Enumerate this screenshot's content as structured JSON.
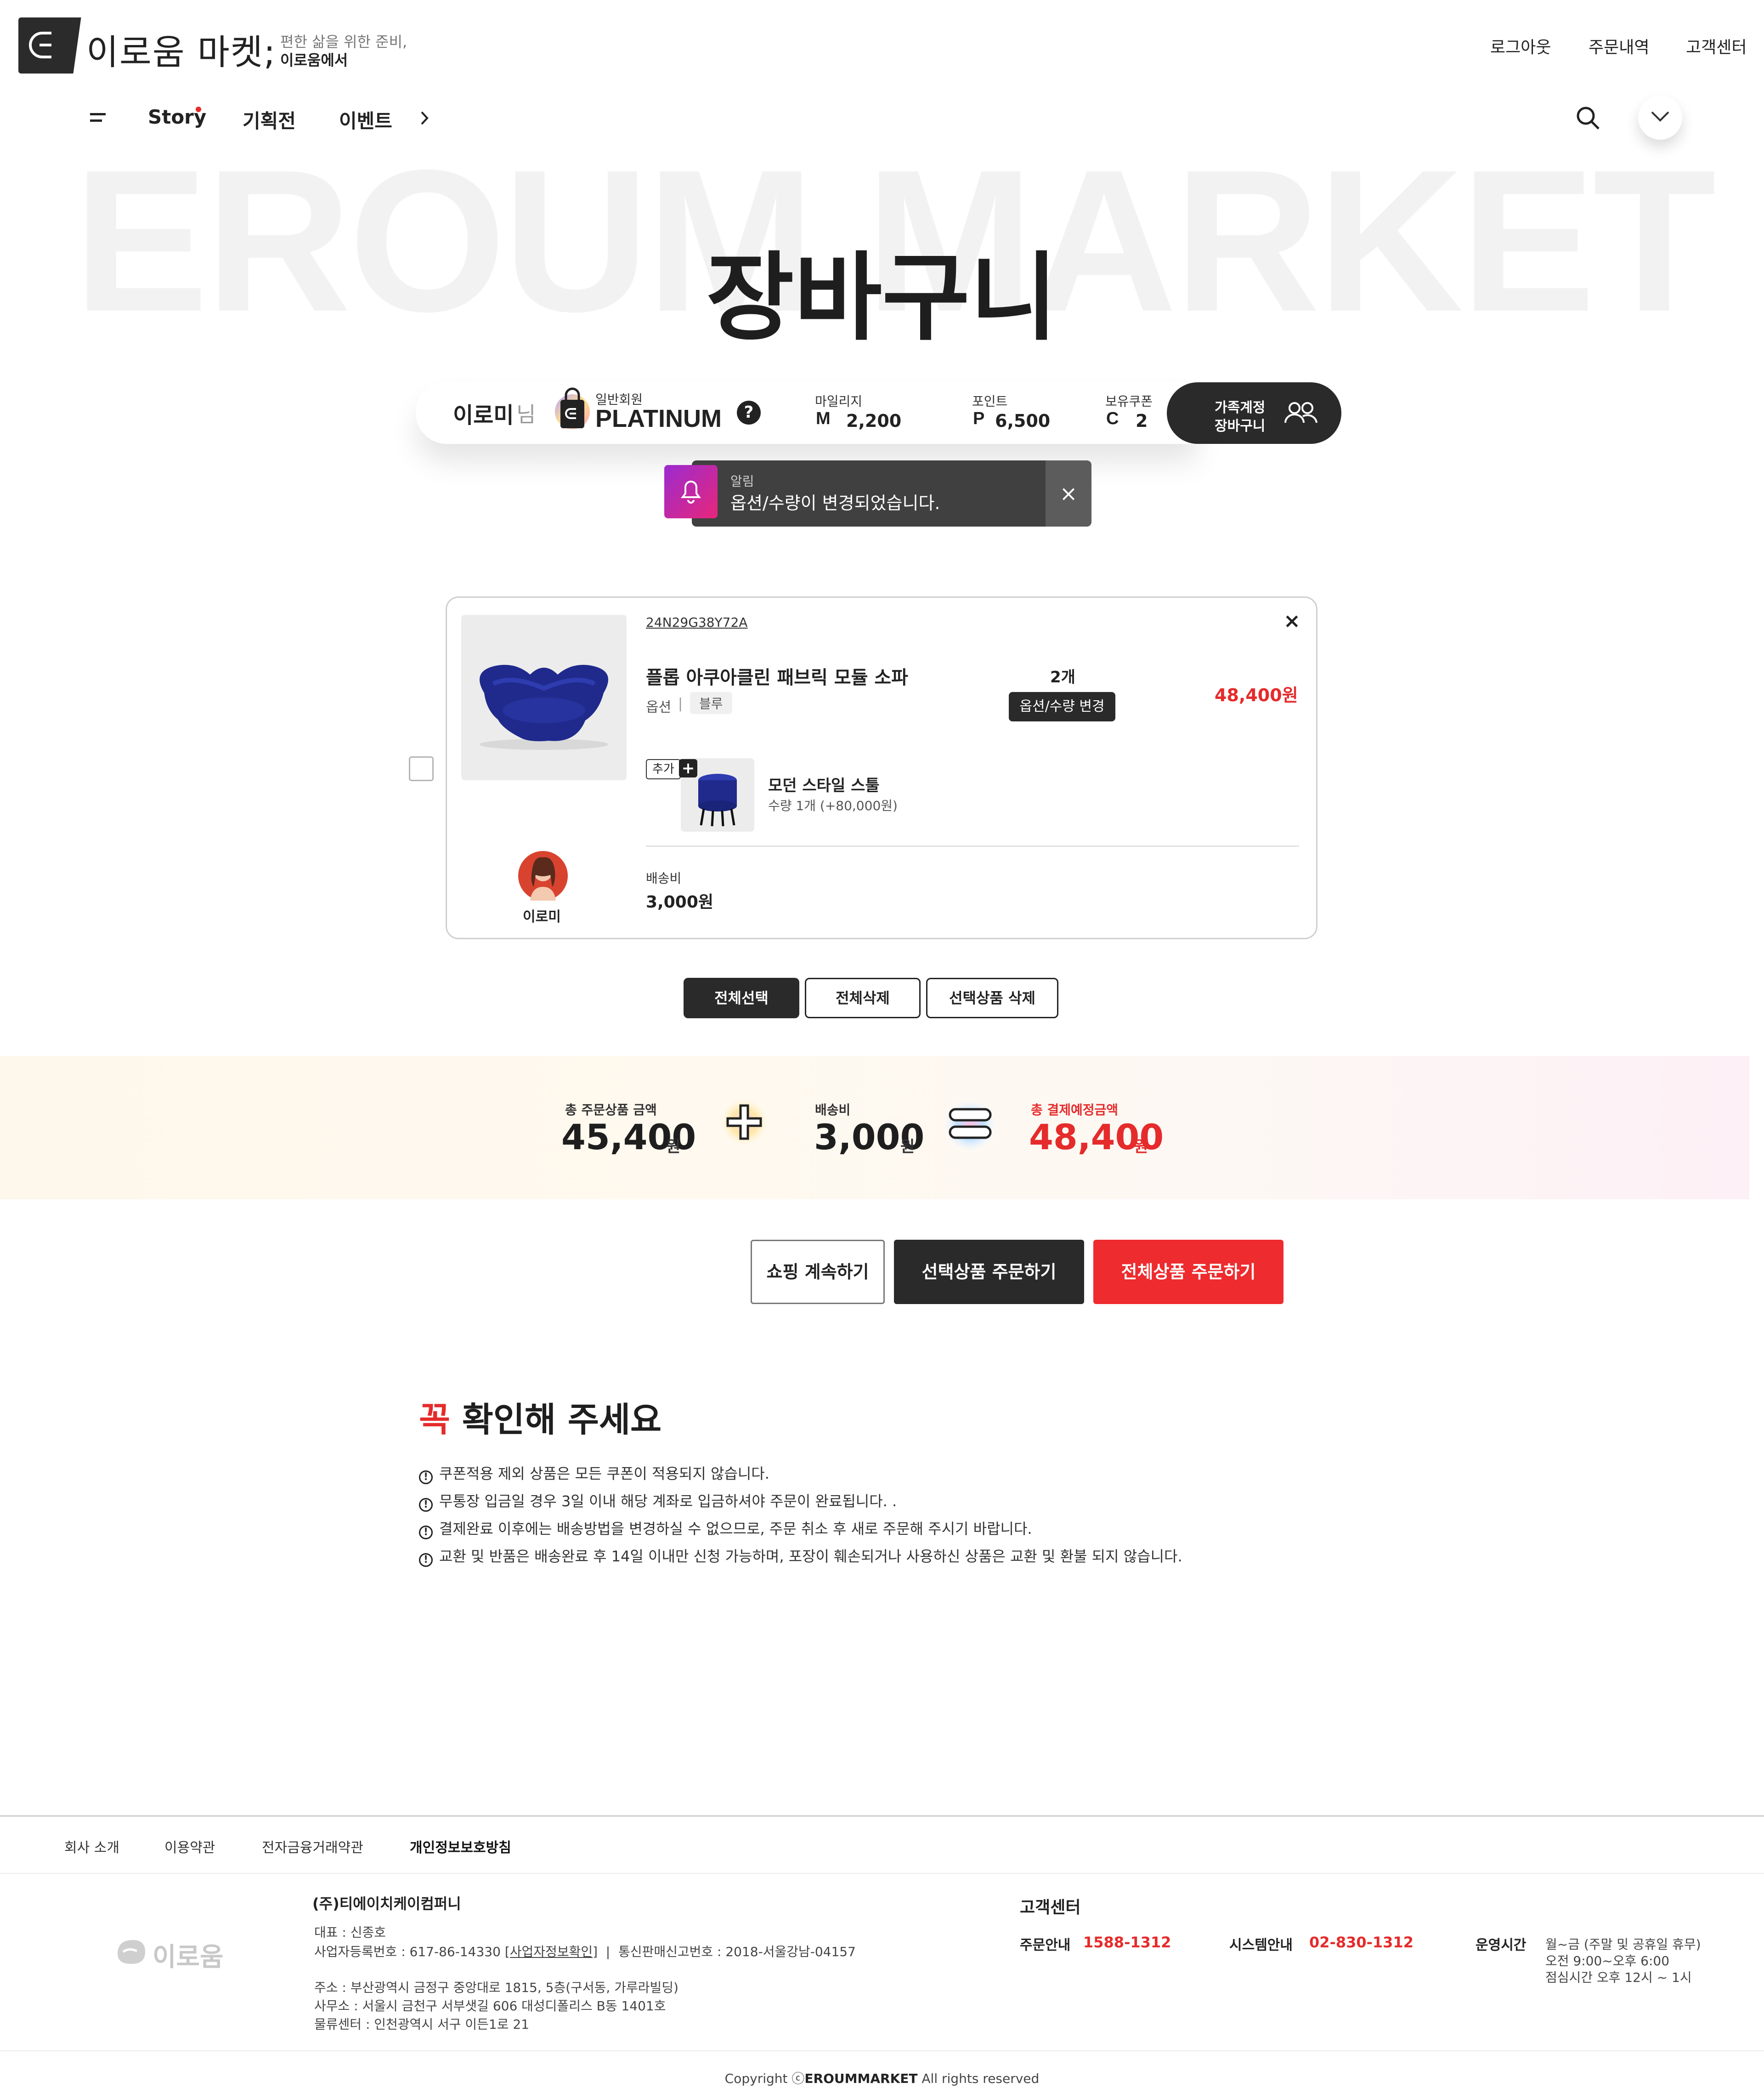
{
  "header": {
    "brand": "이로움 마켓;",
    "tagline_line1": "편한 삶을 위한 준비,",
    "tagline_line2": "이로움에서",
    "top_links": [
      "로그아웃",
      "주문내역",
      "고객센터"
    ],
    "nav": [
      "Story",
      "기획전",
      "이벤트"
    ],
    "watermark": "EROUM MARKET"
  },
  "page": {
    "title": "장바구니"
  },
  "member": {
    "name": "이로미",
    "honorific": "님",
    "grade_label": "일반회원",
    "grade": "PLATINUM",
    "mileage_label": "마일리지",
    "mileage_value": "2,200",
    "point_label": "포인트",
    "point_value": "6,500",
    "coupon_label": "보유쿠폰",
    "coupon_value": "2",
    "family_cart_line1": "가족계정",
    "family_cart_line2": "장바구니"
  },
  "toast": {
    "title": "알림",
    "message": "옵션/수량이 변경되었습니다.",
    "close": "×"
  },
  "cart_item": {
    "code": "24N29G38Y72A",
    "name": "플롭 아쿠아클린 패브릭 모듈 소파",
    "option_label": "옵션",
    "option_value": "블루",
    "quantity": "2개",
    "change_button": "옵션/수량 변경",
    "price": "48,400원",
    "addon_badge": "추가",
    "addon_name": "모던 스타일 스툴",
    "addon_detail": "수량 1개 (+80,000원)",
    "owner_name": "이로미",
    "shipping_label": "배송비",
    "shipping_value": "3,000원",
    "remove": "×"
  },
  "cart_actions": [
    "전체선택",
    "전체삭제",
    "선택상품 삭제"
  ],
  "summary": {
    "items_label": "총 주문상품 금액",
    "items_value": "45,400",
    "shipping_label": "배송비",
    "shipping_value": "3,000",
    "total_label": "총 결제예정금액",
    "total_value": "48,400",
    "unit": "원"
  },
  "order_buttons": [
    "쇼핑 계속하기",
    "선택상품 주문하기",
    "전체상품 주문하기"
  ],
  "notice": {
    "title_accent": "꼭",
    "title_rest": " 확인해 주세요",
    "items": [
      "쿠폰적용 제외 상품은 모든 쿠폰이 적용되지 않습니다.",
      "무통장 입금일 경우 3일 이내 해당 계좌로 입금하셔야 주문이 완료됩니다. .",
      "결제완료 이후에는 배송방법을 변경하실 수 없으므로, 주문 취소 후 새로 주문해 주시기 바랍니다.",
      "교환 및 반품은 배송완료 후 14일 이내만 신청 가능하며, 포장이 훼손되거나 사용하신 상품은 교환 및 환불 되지 않습니다."
    ]
  },
  "footer": {
    "links": [
      "회사 소개",
      "이용약관",
      "전자금융거래약관",
      "개인정보보호방침"
    ],
    "logo_text": "이로움",
    "company": "(주)티에이치케이컴퍼니",
    "ceo": "대표 : 신종호",
    "biz_number": "사업자등록번호 : 617-86-14330",
    "biz_link": "[사업자정보확인]",
    "ecommerce_number": "통신판매신고번호 : 2018-서울강남-04157",
    "address": "주소 : 부산광역시 금정구 중앙대로 1815, 5층(구서동, 가루라빌딩)",
    "office": "사무소 : 서울시 금천구 서부샛길 606 대성디폴리스 B동 1401호",
    "logistics": "물류센터 : 인천광역시 서구 이든1로 21",
    "cs_title": "고객센터",
    "order_info_label": "주문안내",
    "order_info_phone": "1588-1312",
    "system_info_label": "시스템안내",
    "system_info_phone": "02-830-1312",
    "hours_label": "운영시간",
    "hours_line1": "월~금 (주말 및 공휴일 휴무)",
    "hours_line2": "오전 9:00~오후 6:00",
    "hours_line3": "점심시간 오후 12시 ~ 1시",
    "copyright_pre": "Copyright ⓒ",
    "copyright_brand": "EROUMMARKET",
    "copyright_post": " All rights reserved"
  },
  "colors": {
    "accent_red": "#e52b2b",
    "dark": "#2a2a2a"
  }
}
